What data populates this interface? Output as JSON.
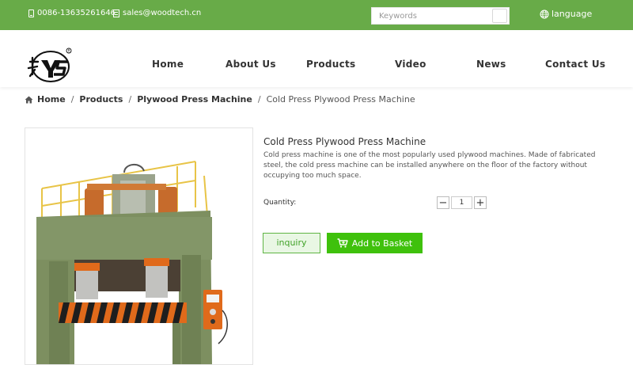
{
  "topbar": {
    "phone": "0086-13635261646",
    "email": "sales@woodtech.cn",
    "search_placeholder": "Keywords",
    "language": "language"
  },
  "nav": {
    "items": [
      "Home",
      "About Us",
      "Products",
      "Video",
      "News",
      "Contact Us"
    ]
  },
  "breadcrumb": {
    "items": [
      "Home",
      "Products",
      "Plywood Press Machine"
    ],
    "current": "Cold Press Plywood Press Machine",
    "separator": "/"
  },
  "product": {
    "title": "Cold Press Plywood Press Machine",
    "description": "Cold press machine is one of the most popularly used plywood machines. Made of fabricated steel, the cold press machine can be installed anywhere on the floor of the factory without occupying too much space.",
    "quantity_label": "Quantity:",
    "quantity_value": "1",
    "minus": "−",
    "plus": "+",
    "inquiry_label": "inquiry",
    "basket_label": "Add to Basket"
  },
  "colors": {
    "topbar": "#68ab48",
    "basket_button": "#3fc10c",
    "inquiry_border": "#5fb544",
    "machine_body": "#7d8f60",
    "hazard_orange": "#e06a1b",
    "railing_yellow": "#e8c447"
  }
}
